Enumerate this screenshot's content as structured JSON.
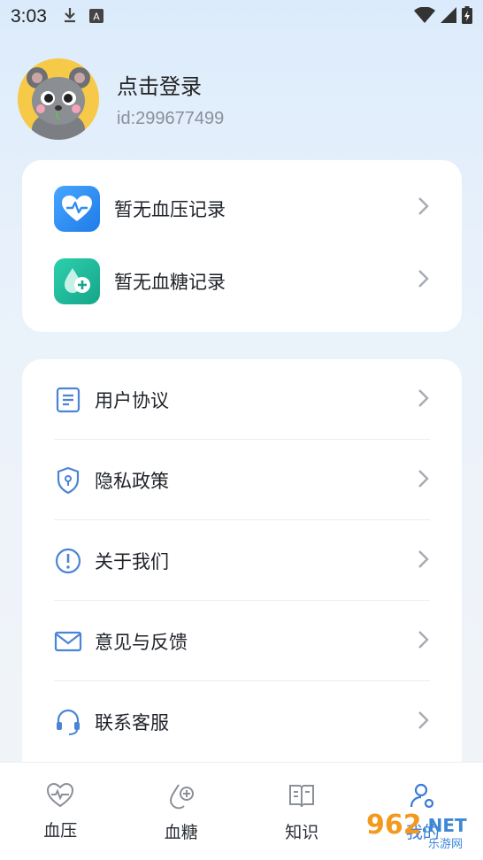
{
  "status_bar": {
    "time": "3:03",
    "icons": [
      "download-icon",
      "a-icon",
      "wifi-icon",
      "signal-icon",
      "battery-icon"
    ]
  },
  "profile": {
    "name": "点击登录",
    "id": "id:299677499"
  },
  "records": [
    {
      "label": "暂无血压记录",
      "icon": "heart-pulse-icon",
      "color": "#2f8ef2"
    },
    {
      "label": "暂无血糖记录",
      "icon": "blood-drop-icon",
      "color": "#1eb89a"
    }
  ],
  "menu": [
    {
      "label": "用户协议",
      "icon": "document-icon"
    },
    {
      "label": "隐私政策",
      "icon": "shield-icon"
    },
    {
      "label": "关于我们",
      "icon": "info-icon"
    },
    {
      "label": "意见与反馈",
      "icon": "mail-icon"
    },
    {
      "label": "联系客服",
      "icon": "headset-icon"
    }
  ],
  "tabs": [
    {
      "label": "血压",
      "icon": "heart-pulse-outline-icon"
    },
    {
      "label": "血糖",
      "icon": "drop-plus-outline-icon"
    },
    {
      "label": "知识",
      "icon": "book-icon"
    },
    {
      "label": "我的",
      "icon": "user-icon",
      "active": true
    }
  ],
  "watermark": "962.NET 乐游网",
  "colors": {
    "accent": "#3a7bd5",
    "icon_blue": "#4b84d6"
  }
}
